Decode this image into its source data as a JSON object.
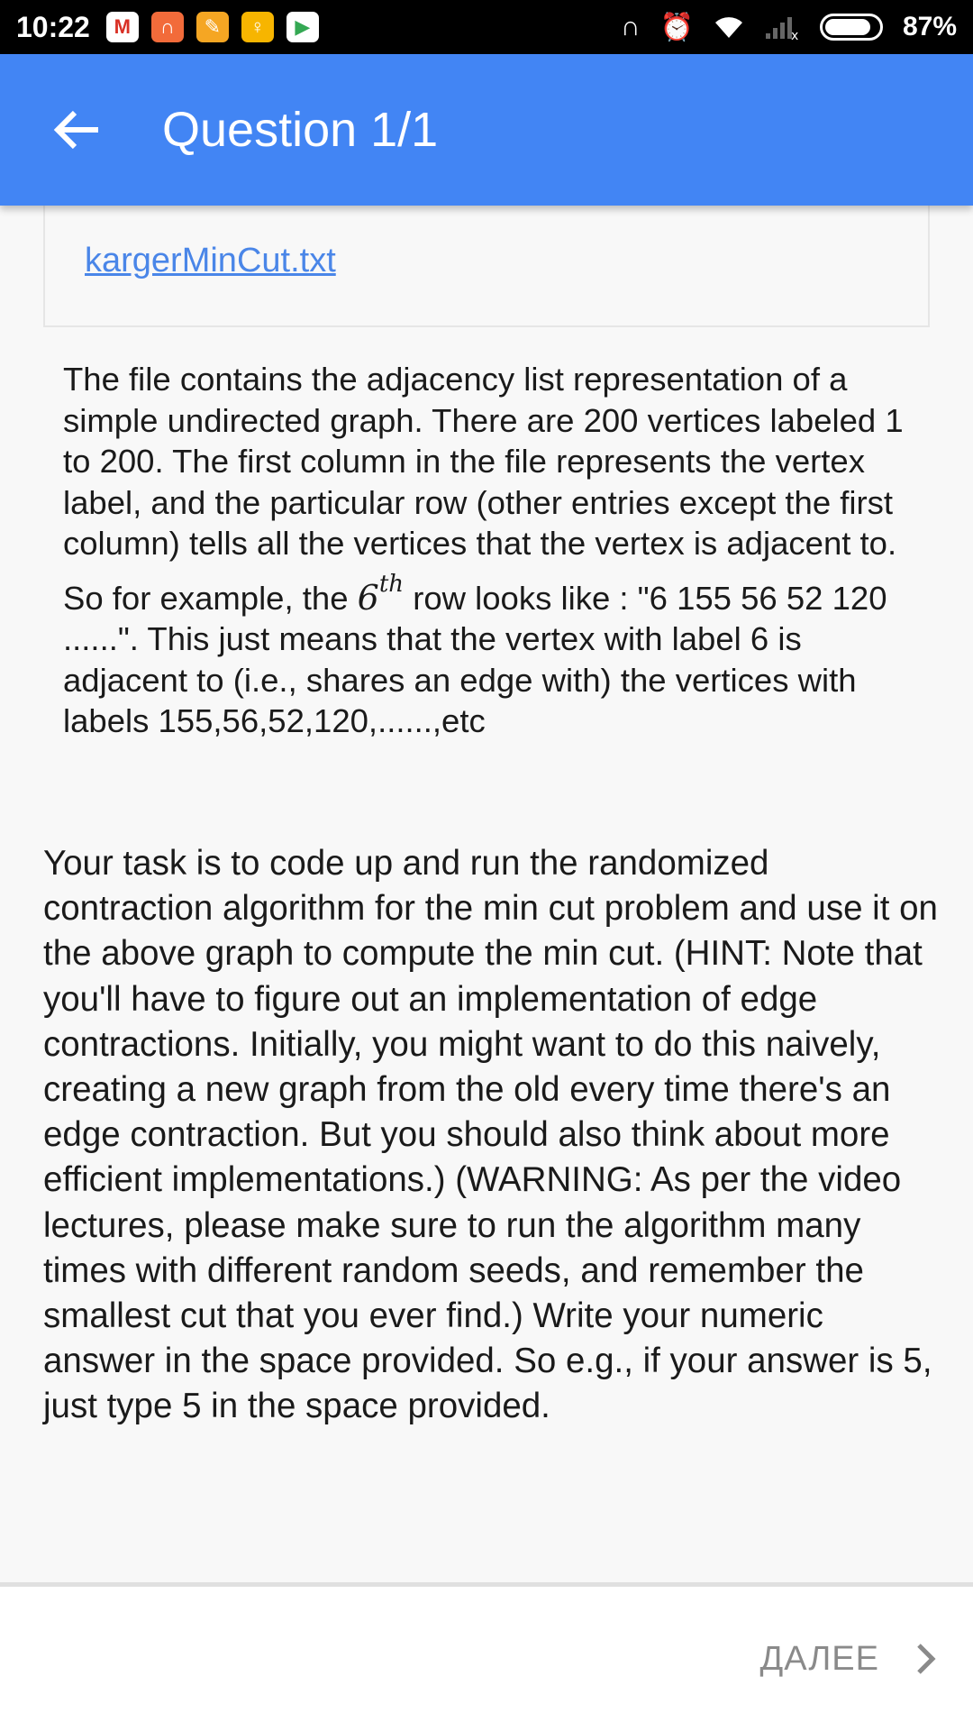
{
  "status_bar": {
    "time": "10:22",
    "notifications": [
      {
        "icon": "gmail-icon",
        "glyph": "M",
        "color": "#ffffff",
        "text_color": "#d93025"
      },
      {
        "icon": "headphones-icon",
        "glyph": "∩",
        "color": "#f26b3a",
        "text_color": "#ffffff"
      },
      {
        "icon": "app-orange-icon",
        "glyph": "✎",
        "color": "#f5a623",
        "text_color": "#ffffff"
      },
      {
        "icon": "lightbulb-icon",
        "glyph": "♀",
        "color": "#f7b500",
        "text_color": "#ffffff"
      },
      {
        "icon": "play-store-icon",
        "glyph": "▶",
        "color": "#ffffff",
        "text_color": "#34a853"
      }
    ],
    "battery_percent": "87%",
    "battery_level": 0.87
  },
  "app_bar": {
    "title": "Question 1/1",
    "color": "#4285f4"
  },
  "attachment": {
    "file_name": "kargerMinCut.txt"
  },
  "description": {
    "part1": "The file contains the adjacency list representation of a simple undirected graph. There are 200 vertices labeled 1 to 200. The first column in the file represents the vertex label, and the particular row (other entries except the first column) tells all the vertices that the vertex is adjacent to. So for example, the ",
    "math_base": "6",
    "math_sup": "th",
    "part2": " row looks like : \"6 155 56 52 120 ......\". This just means that the vertex with label 6 is adjacent to (i.e., shares an edge with) the vertices with labels 155,56,52,120,......,etc"
  },
  "task": {
    "text": "Your task is to code up and run the randomized contraction algorithm for the min cut problem and use it on the above graph to compute the min cut. (HINT: Note that you'll have to figure out an implementation of edge contractions. Initially, you might want to do this naively, creating a new graph from the old every time there's an edge contraction. But you should also think about more efficient implementations.) (WARNING: As per the video lectures, please make sure to run the algorithm many times with different random seeds, and remember the smallest cut that you ever find.) Write your numeric answer in the space provided. So e.g., if your answer is 5, just type 5 in the space provided."
  },
  "bottom_bar": {
    "next_label": "ДАЛЕЕ"
  }
}
